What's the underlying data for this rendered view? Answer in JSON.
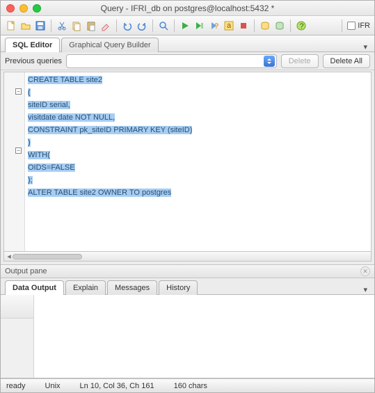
{
  "window": {
    "title": "Query - IFRI_db on postgres@localhost:5432 *"
  },
  "toolbar_right": {
    "label": "IFR"
  },
  "tabs": {
    "sql_editor": "SQL Editor",
    "gqb": "Graphical Query Builder"
  },
  "prev_queries": {
    "label": "Previous queries",
    "delete": "Delete",
    "delete_all": "Delete All"
  },
  "sql": {
    "l1": "CREATE TABLE site2",
    "l2": "(",
    "l3": "siteID serial,",
    "l4": "visitdate date NOT NULL,",
    "l5": "CONSTRAINT pk_siteID PRIMARY KEY (siteID)",
    "l6": ")",
    "l7": "WITH(",
    "l8": "OIDS=FALSE",
    "l9": ");",
    "l10": "ALTER TABLE site2 OWNER TO postgres"
  },
  "output": {
    "pane_label": "Output pane",
    "tabs": {
      "data": "Data Output",
      "explain": "Explain",
      "messages": "Messages",
      "history": "History"
    }
  },
  "status": {
    "ready": "ready",
    "encoding": "Unix",
    "position": "Ln 10, Col 36, Ch 161",
    "chars": "160 chars"
  }
}
